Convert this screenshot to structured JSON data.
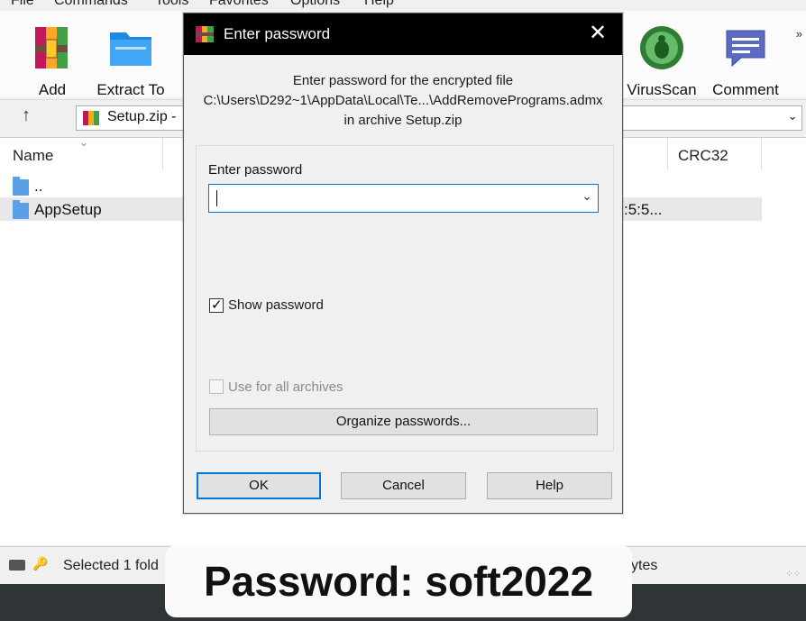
{
  "menu": [
    "File",
    "Commands",
    "Tools",
    "Favorites",
    "Options",
    "Help"
  ],
  "toolbar": {
    "buttons": [
      {
        "label": "Add",
        "icon": "add-archive-icon"
      },
      {
        "label": "Extract To",
        "icon": "extract-folder-icon"
      },
      {
        "label": "VirusScan",
        "icon": "virus-scan-icon"
      },
      {
        "label": "Comment",
        "icon": "comment-icon"
      }
    ],
    "more": "»"
  },
  "address": {
    "text": "Setup.zip -",
    "dropdown": "chevron-down-icon"
  },
  "columns": [
    "Name",
    "CRC32"
  ],
  "rows": [
    {
      "name": ".."
    },
    {
      "name": "AppSetup",
      "partial_value": ":5:5..."
    }
  ],
  "status": {
    "left": "Selected 1 fold",
    "right": "ytes"
  },
  "dialog": {
    "title": "Enter password",
    "message_line1": "Enter password for the encrypted file",
    "message_line2": "C:\\Users\\D292~1\\AppData\\Local\\Te...\\AddRemovePrograms.admx",
    "message_line3": "in archive Setup.zip",
    "password_label": "Enter password",
    "password_value": "",
    "show_password": {
      "label": "Show password",
      "checked": true
    },
    "use_all_archives": {
      "label": "Use for all archives",
      "checked": false,
      "enabled": false
    },
    "organize_button": "Organize passwords...",
    "ok_button": "OK",
    "cancel_button": "Cancel",
    "help_button": "Help"
  },
  "caption": "Password: soft2022",
  "colors": {
    "accent": "#0078d7",
    "title_bar": "#000000",
    "folder": "#5aa0e6"
  }
}
